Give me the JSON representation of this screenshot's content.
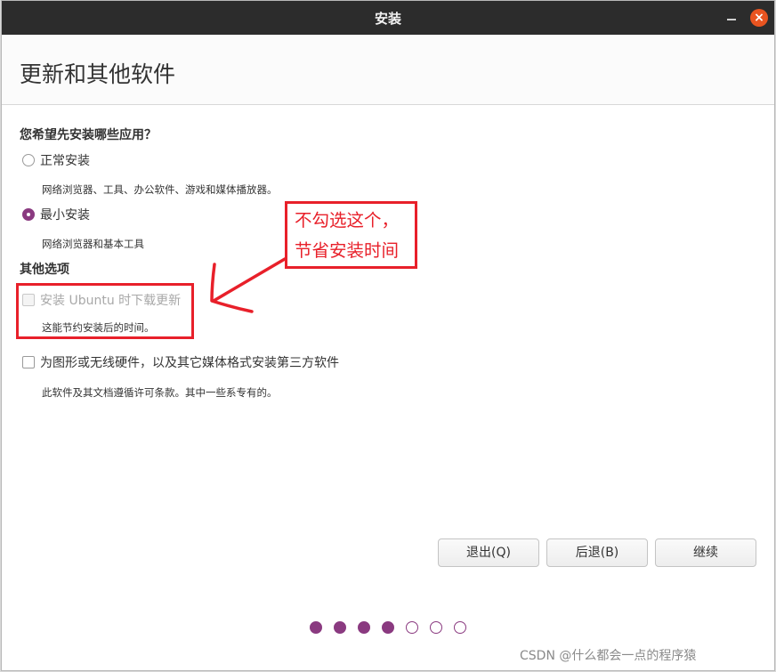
{
  "window": {
    "title": "安装",
    "close_glyph": "×"
  },
  "page": {
    "title": "更新和其他软件"
  },
  "apps_section": {
    "heading": "您希望先安装哪些应用？",
    "normal": {
      "label": "正常安装",
      "desc": "网络浏览器、工具、办公软件、游戏和媒体播放器。",
      "selected": false
    },
    "minimal": {
      "label": "最小安装",
      "desc": "网络浏览器和基本工具",
      "selected": true
    }
  },
  "other_section": {
    "heading": "其他选项",
    "download_updates": {
      "label": "安装 Ubuntu 时下载更新",
      "desc": "这能节约安装后的时间。",
      "checked": false,
      "disabled": true
    },
    "third_party": {
      "label": "为图形或无线硬件，以及其它媒体格式安装第三方软件",
      "desc": "此软件及其文档遵循许可条款。其中一些系专有的。",
      "checked": false
    }
  },
  "buttons": {
    "quit": "退出(Q)",
    "back": "后退(B)",
    "continue": "继续"
  },
  "progress": {
    "total_steps": 7,
    "completed_steps": 4
  },
  "annotation": {
    "line1": "不勾选这个，",
    "line2": "节省安装时间",
    "color": "#e8202a"
  },
  "watermark": "CSDN @什么都会一点的程序猿",
  "colors": {
    "accent": "#8a3a80",
    "titlebar": "#2c2c2c",
    "close": "#e95420"
  },
  "icons": {
    "minimize": "minimize-icon",
    "close": "close-icon",
    "arrow": "annotation-arrow"
  }
}
